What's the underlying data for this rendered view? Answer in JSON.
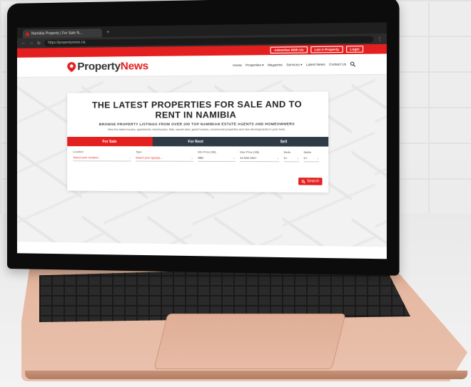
{
  "browser": {
    "tab_title": "Namibia Property | For Sale N...",
    "new_tab_symbol": "+",
    "url": "https://propertynews.na"
  },
  "topbar": {
    "advertise_label": "Advertise With Us",
    "list_label": "List A Property",
    "login_label": "Login"
  },
  "logo": {
    "part1": "Property",
    "part2": "News"
  },
  "menu": {
    "items": [
      "Home",
      "Properties ▾",
      "Magazine",
      "Services ▾",
      "Latest News",
      "Contact Us"
    ]
  },
  "hero": {
    "title": "THE LATEST PROPERTIES FOR SALE AND TO RENT IN NAMIBIA",
    "subtitle": "BROWSE PROPERTY LISTINGS FROM OVER 200 TOP NAMIBIAN ESTATE AGENTS AND HOMEOWNERS",
    "description": "View the latest houses, apartments, townhouses, flats, vacant land, guest houses, commercial properties and new developments in your town."
  },
  "search_tabs": {
    "for_sale": "For Sale",
    "for_rent": "For Rent",
    "sell": "Sell"
  },
  "form": {
    "location_label": "Location",
    "location_value": "Select your location...",
    "type_label": "Type",
    "type_value": "Select your type(s)...",
    "min_price_label": "Min Price (N$)",
    "min_price_value": "N$0",
    "max_price_label": "Max Price (N$)",
    "max_price_value": "10 000 000+",
    "beds_label": "Beds",
    "beds_value": "0+",
    "baths_label": "Baths",
    "baths_value": "0+",
    "search_label": "Search"
  },
  "colors": {
    "brand_red": "#e41f1f",
    "dark_tab": "#2e3a46"
  }
}
